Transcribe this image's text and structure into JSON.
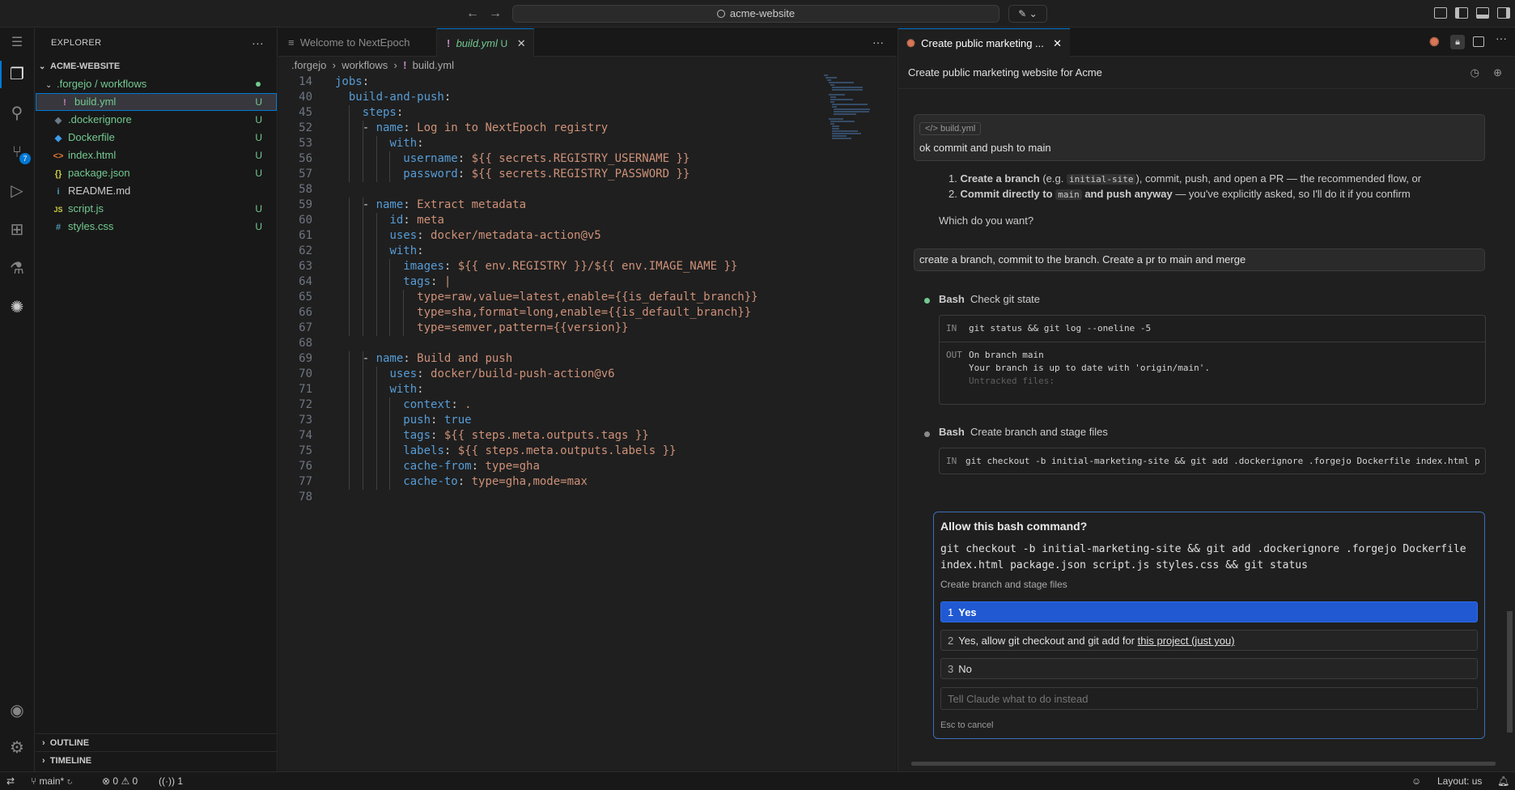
{
  "titlebar": {
    "search_text": "acme-website",
    "back_icon": "arrow-left-icon",
    "forward_icon": "arrow-right-icon"
  },
  "activity": {
    "source_control_badge": "7"
  },
  "sidebar": {
    "title": "EXPLORER",
    "more": "···",
    "root": "ACME-WEBSITE",
    "folder": ".forgejo / workflows",
    "files": [
      {
        "name": "build.yml",
        "icon": "!",
        "status": "U"
      },
      {
        "name": ".dockerignore",
        "icon": "◆",
        "status": "U"
      },
      {
        "name": "Dockerfile",
        "icon": "◆",
        "status": "U"
      },
      {
        "name": "index.html",
        "icon": "<>",
        "status": "U"
      },
      {
        "name": "package.json",
        "icon": "{}",
        "status": "U"
      },
      {
        "name": "README.md",
        "icon": "i",
        "status": ""
      },
      {
        "name": "script.js",
        "icon": "JS",
        "status": "U"
      },
      {
        "name": "styles.css",
        "icon": "#",
        "status": "U"
      }
    ],
    "outline": "OUTLINE",
    "timeline": "TIMELINE"
  },
  "editor": {
    "tabs": [
      {
        "label": "Welcome to NextEpoch"
      },
      {
        "label": "build.yml",
        "status": "U"
      }
    ],
    "more": "···",
    "breadcrumb": [
      ".forgejo",
      "workflows",
      "build.yml"
    ],
    "lines": [
      {
        "n": "14",
        "indent": 0,
        "key": "jobs",
        "sep": ":",
        "val": ""
      },
      {
        "n": "40",
        "indent": 1,
        "key": "build-and-push",
        "sep": ":",
        "val": ""
      },
      {
        "n": "45",
        "indent": 2,
        "key": "steps",
        "sep": ":",
        "val": ""
      },
      {
        "n": "52",
        "indent": 3,
        "dash": true,
        "key": "name",
        "sep": ": ",
        "val": "Log in to NextEpoch registry"
      },
      {
        "n": "53",
        "indent": 4,
        "key": "with",
        "sep": ":",
        "val": ""
      },
      {
        "n": "56",
        "indent": 5,
        "key": "username",
        "sep": ": ",
        "val": "${{ secrets.REGISTRY_USERNAME }}"
      },
      {
        "n": "57",
        "indent": 5,
        "key": "password",
        "sep": ": ",
        "val": "${{ secrets.REGISTRY_PASSWORD }}"
      },
      {
        "n": "58",
        "indent": 0,
        "key": "",
        "sep": "",
        "val": ""
      },
      {
        "n": "59",
        "indent": 3,
        "dash": true,
        "key": "name",
        "sep": ": ",
        "val": "Extract metadata"
      },
      {
        "n": "60",
        "indent": 4,
        "key": "id",
        "sep": ": ",
        "val": "meta"
      },
      {
        "n": "61",
        "indent": 4,
        "key": "uses",
        "sep": ": ",
        "val": "docker/metadata-action@v5"
      },
      {
        "n": "62",
        "indent": 4,
        "key": "with",
        "sep": ":",
        "val": ""
      },
      {
        "n": "63",
        "indent": 5,
        "key": "images",
        "sep": ": ",
        "val": "${{ env.REGISTRY }}/${{ env.IMAGE_NAME }}"
      },
      {
        "n": "64",
        "indent": 5,
        "key": "tags",
        "sep": ": ",
        "val": "|"
      },
      {
        "n": "65",
        "indent": 6,
        "key": "",
        "sep": "",
        "val": "type=raw,value=latest,enable={{is_default_branch}}"
      },
      {
        "n": "66",
        "indent": 6,
        "key": "",
        "sep": "",
        "val": "type=sha,format=long,enable={{is_default_branch}}"
      },
      {
        "n": "67",
        "indent": 6,
        "key": "",
        "sep": "",
        "val": "type=semver,pattern={{version}}"
      },
      {
        "n": "68",
        "indent": 0,
        "key": "",
        "sep": "",
        "val": ""
      },
      {
        "n": "69",
        "indent": 3,
        "dash": true,
        "key": "name",
        "sep": ": ",
        "val": "Build and push"
      },
      {
        "n": "70",
        "indent": 4,
        "key": "uses",
        "sep": ": ",
        "val": "docker/build-push-action@v6"
      },
      {
        "n": "71",
        "indent": 4,
        "key": "with",
        "sep": ":",
        "val": ""
      },
      {
        "n": "72",
        "indent": 5,
        "key": "context",
        "sep": ": ",
        "val": "."
      },
      {
        "n": "73",
        "indent": 5,
        "key": "push",
        "sep": ": ",
        "val": "true",
        "bool": true
      },
      {
        "n": "74",
        "indent": 5,
        "key": "tags",
        "sep": ": ",
        "val": "${{ steps.meta.outputs.tags }}"
      },
      {
        "n": "75",
        "indent": 5,
        "key": "labels",
        "sep": ": ",
        "val": "${{ steps.meta.outputs.labels }}"
      },
      {
        "n": "76",
        "indent": 5,
        "key": "cache-from",
        "sep": ": ",
        "val": "type=gha"
      },
      {
        "n": "77",
        "indent": 5,
        "key": "cache-to",
        "sep": ": ",
        "val": "type=gha,mode=max"
      },
      {
        "n": "78",
        "indent": 0,
        "key": "",
        "sep": "",
        "val": ""
      }
    ]
  },
  "chat": {
    "tab_label": "Create public marketing ...",
    "header_title": "Create public marketing website for Acme",
    "user_msg1": {
      "chip": "build.yml",
      "text": "ok commit and push to main"
    },
    "assistant": {
      "item1_bold": "Create a branch",
      "item1_pre": " (e.g. ",
      "item1_code": "initial-site",
      "item1_post": "), commit, push, and open a PR — the recommended flow, or",
      "item2_bold": "Commit directly to ",
      "item2_code": "main",
      "item2_bold2": " and push anyway",
      "item2_post": " — you've explicitly asked, so I'll do it if you confirm",
      "question": "Which do you want?"
    },
    "user_msg2": "create a branch, commit to the branch. Create a pr to main and merge",
    "tool1": {
      "name": "Bash",
      "desc": "Check git state",
      "in_label": "IN",
      "in": "git status && git log --oneline -5",
      "out_label": "OUT",
      "out1": "On branch main",
      "out2": "Your branch is up to date with 'origin/main'.",
      "out3": "Untracked files:"
    },
    "tool2": {
      "name": "Bash",
      "desc": "Create branch and stage files",
      "in_label": "IN",
      "in": "git checkout -b initial-marketing-site && git add .dockerignore .forgejo Dockerfile index.html p"
    },
    "permission": {
      "title": "Allow this bash command?",
      "cmd1": "git checkout -b initial-marketing-site && git add .dockerignore .forgejo Dockerfile",
      "cmd2": "index.html package.json script.js styles.css && git status",
      "desc": "Create branch and stage files",
      "opt1_num": "1",
      "opt1": "Yes",
      "opt2_num": "2",
      "opt2_pre": "Yes, allow git checkout and git add for ",
      "opt2_link": "this project (just you)",
      "opt3_num": "3",
      "opt3": "No",
      "input_placeholder": "Tell Claude what to do instead",
      "esc": "Esc to cancel"
    }
  },
  "statusbar": {
    "branch": "main*",
    "errors": "0",
    "warnings": "0",
    "ports": "1",
    "layout": "Layout: us"
  }
}
